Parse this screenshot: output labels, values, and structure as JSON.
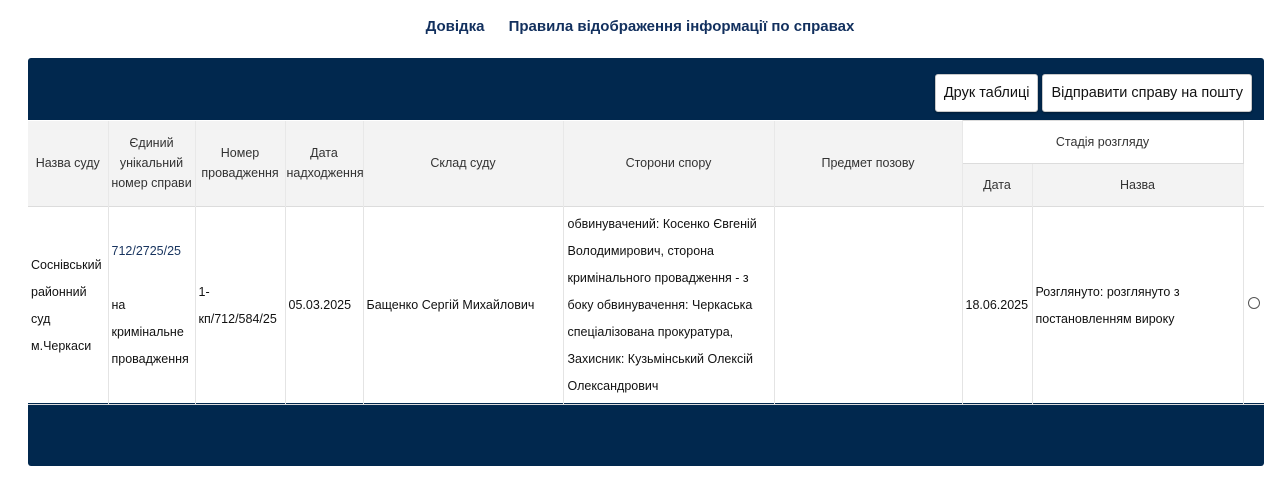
{
  "nav": {
    "help": "Довідка",
    "rules": "Правила відображення інформації по справах"
  },
  "toolbar": {
    "print_label": "Друк таблиці",
    "send_label": "Відправити справу на пошту"
  },
  "table": {
    "headers": {
      "court": "Назва суду",
      "unique_num": "Єдиний унікальний номер справи",
      "proceeding_num": "Номер провадження",
      "received_date": "Дата надходження",
      "composition": "Склад суду",
      "parties": "Сторони спору",
      "subject": "Предмет позову",
      "stage_group": "Стадія розгляду",
      "stage_date": "Дата",
      "stage_name": "Назва"
    },
    "rows": [
      {
        "court": "Соснівський районний суд м.Черкаси",
        "case_number": "712/2725/25",
        "case_type": "на кримінальне провадження",
        "proceeding_number": "1-кп/712/584/25",
        "received_date": "05.03.2025",
        "composition": "Бащенко Сергій Михайлович",
        "parties": "обвинувачений: Косенко Євгеній Володимирович, сторона кримінального провадження - з боку обвинувачення: Черкаська спеціалізована прокуратура, Захисник: Кузьмінський Олексій Олександрович",
        "subject": "",
        "stage_date": "18.06.2025",
        "stage_name": "Розглянуто: розглянуто з постановленням вироку"
      }
    ]
  },
  "colors": {
    "panel": "#01284e",
    "link": "#12305e"
  }
}
